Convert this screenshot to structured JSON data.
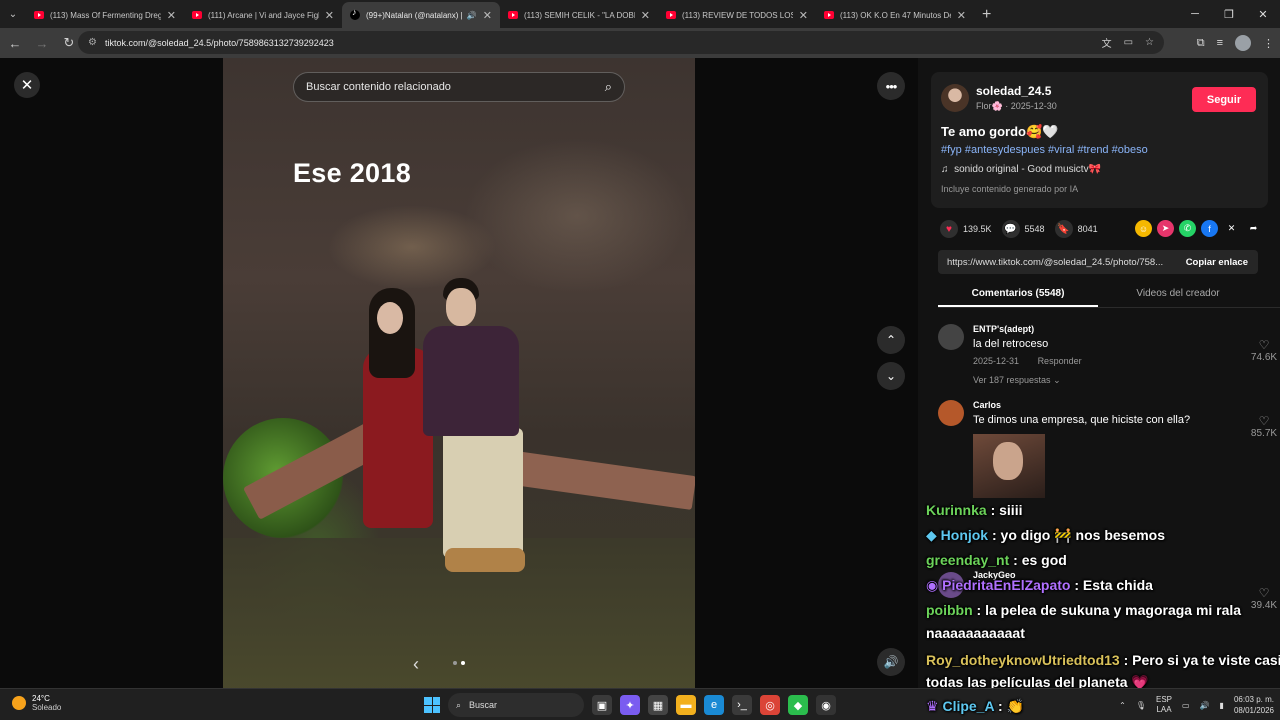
{
  "browser": {
    "tabs": [
      {
        "title": "(113) Mass Of Fermenting Dreg",
        "icon": "youtube-icon",
        "active": false,
        "audio": false
      },
      {
        "title": "(111) Arcane | Vi and Jayce Figh",
        "icon": "youtube-icon",
        "active": false,
        "audio": false
      },
      {
        "title": "(99+)Natalan (@natalanx) |",
        "icon": "tiktok-icon",
        "active": true,
        "audio": true
      },
      {
        "title": "(113) SEMIH CELIK - \"LA DOBLE",
        "icon": "youtube-icon",
        "active": false,
        "audio": false
      },
      {
        "title": "(113) REVIEW DE TODOS LOS M",
        "icon": "youtube-icon",
        "active": false,
        "audio": false
      },
      {
        "title": "(113) OK K.O En 47 Minutos De",
        "icon": "youtube-icon",
        "active": false,
        "audio": false
      }
    ],
    "url": "tiktok.com/@soledad_24.5/photo/7589863132739292423"
  },
  "viewer": {
    "search_placeholder": "Buscar contenido relacionado",
    "overlay_text": "Ese 2018",
    "slide_current": 2,
    "slide_total": 2
  },
  "post": {
    "username": "soledad_24.5",
    "meta": "Flor🌸 · 2025-12-30",
    "follow_label": "Seguir",
    "caption": "Te amo gordo🥰🤍",
    "hashtags": "#fyp #antesydespues #viral #trend #obeso",
    "sound": "sonido original - Good musictv🎀",
    "ai_note": "Incluye contenido generado por IA",
    "likes": "139.5K",
    "comments": "5548",
    "saves": "8041",
    "link": "https://www.tiktok.com/@soledad_24.5/photo/758...",
    "copy_label": "Copiar enlace"
  },
  "tabs": {
    "comments": "Comentarios (5548)",
    "creator_videos": "Videos del creador"
  },
  "comments": [
    {
      "name": "ENTP's(adept)",
      "text": "la del retroceso",
      "date": "2025-12-31",
      "reply": "Responder",
      "replies": "Ver 187 respuestas",
      "likes": "74.6K"
    },
    {
      "name": "Carlos",
      "text": "Te dimos una empresa, que hiciste con ella?",
      "likes": "85.7K"
    },
    {
      "name": "JackyGeo",
      "likes": "39.4K"
    }
  ],
  "chat": [
    {
      "user": "Kurinnka",
      "color": "#6cd35a",
      "msg": " : siiii"
    },
    {
      "user": "Honjok",
      "color": "#5ec8f0",
      "msg": " : yo digo 🚧 nos besemos"
    },
    {
      "user": "greenday_nt",
      "color": "#6cd35a",
      "msg": " : es god"
    },
    {
      "user": "PiedritaEnElZapato",
      "color": "#b070ff",
      "msg": " : Esta chida"
    },
    {
      "user": "poibbn",
      "color": "#6cd35a",
      "msg": " : la pelea de sukuna y magoraga mi rala"
    },
    {
      "user": "",
      "color": "#ffffff",
      "msg": "naaaaaaaaaaat"
    },
    {
      "user": "Roy_dotheyknowUtriedtod13",
      "color": "#d9c15a",
      "msg": " : Pero si ya te viste casi"
    },
    {
      "user": "",
      "color": "#ffffff",
      "msg": "todas las películas del planeta 💗"
    },
    {
      "user": "Clipe_A",
      "color": "#5ec8f0",
      "msg": " : 👏"
    }
  ],
  "taskbar": {
    "temp": "24°C",
    "weather": "Soleado",
    "search": "Buscar",
    "lang1": "ESP",
    "lang2": "LAA",
    "time": "06:03 p. m.",
    "date": "08/01/2026"
  }
}
